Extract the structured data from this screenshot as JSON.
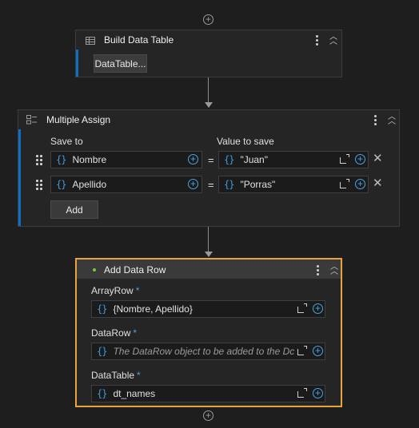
{
  "build_data_table": {
    "title": "Build Data Table",
    "button_label": "DataTable..."
  },
  "multiple_assign": {
    "title": "Multiple Assign",
    "col_save_to": "Save to",
    "col_value": "Value to save",
    "rows": [
      {
        "target": "Nombre",
        "equals": "=",
        "value": "\"Juan\""
      },
      {
        "target": "Apellido",
        "equals": "=",
        "value": "\"Porras\""
      }
    ],
    "add_label": "Add"
  },
  "add_data_row": {
    "title": "Add Data Row",
    "array_row_label": "ArrayRow",
    "array_row_value": "{Nombre, Apellido}",
    "data_row_label": "DataRow",
    "data_row_placeholder": "The DataRow object to be added to the Dc",
    "data_table_label": "DataTable",
    "data_table_value": "dt_names",
    "required_mark": "*"
  },
  "brace_glyph": "{}",
  "colors": {
    "accent": "#0e70c0",
    "selected": "#e8a33a",
    "brace": "#3d9bdc",
    "status": "#7cc24a"
  }
}
